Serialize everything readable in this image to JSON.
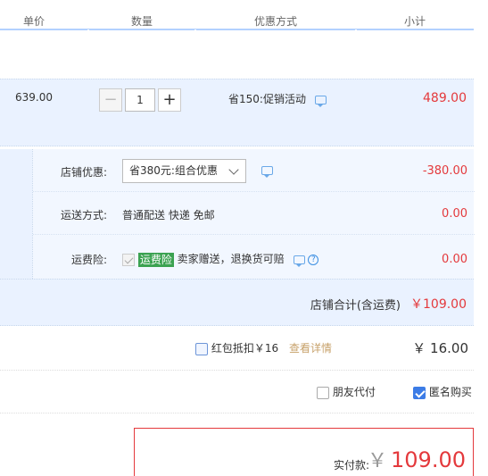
{
  "header": {
    "col_price": "单价",
    "col_qty": "数量",
    "col_promo": "优惠方式",
    "col_subtotal": "小计"
  },
  "item": {
    "unit_price": "639.00",
    "qty_minus": "−",
    "quantity": "1",
    "qty_plus": "+",
    "promo_text": "省150:促销活动",
    "subtotal": "489.00"
  },
  "shop": {
    "discount_label": "店铺优惠:",
    "discount_select": "省380元:组合优惠",
    "discount_amount": "-380.00",
    "shipping_label": "运送方式:",
    "shipping_value": "普通配送 快递 免邮",
    "shipping_amount": "0.00",
    "insurance_label": "运费险:",
    "insurance_badge": "运费险",
    "insurance_text": "卖家赠送，退换货可赔",
    "insurance_amount": "0.00",
    "help_symbol": "?",
    "total_label": "店铺合计(含运费)",
    "total_amount": "￥109.00"
  },
  "redpack": {
    "label": "红包抵扣￥16",
    "detail_link": "查看详情",
    "amount": "￥ 16.00"
  },
  "options": {
    "friend_pay": "朋友代付",
    "anonymous": "匿名购买",
    "anonymous_checked": true
  },
  "payment": {
    "label": "实付款:",
    "currency": "￥",
    "amount": "109.00"
  },
  "colors": {
    "price_red": "#e4393c",
    "header_line": "#b2d1ff",
    "row_bg": "#eaf2ff",
    "insurance_green": "#3ba251",
    "link_gold": "#c7a16a"
  }
}
